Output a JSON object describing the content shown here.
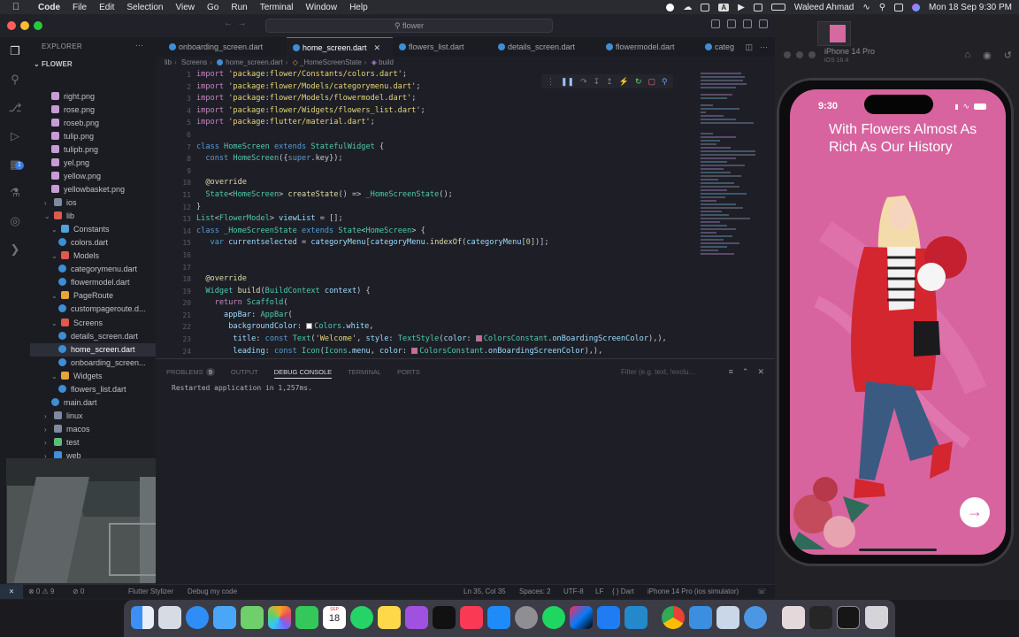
{
  "menubar": {
    "app": "Code",
    "items": [
      "File",
      "Edit",
      "Selection",
      "View",
      "Go",
      "Run",
      "Terminal",
      "Window",
      "Help"
    ],
    "user": "Waleed Ahmad",
    "clock": "Mon 18 Sep  9:30 PM",
    "badge_a": "A"
  },
  "window": {
    "search": "flower"
  },
  "explorer": {
    "header": "EXPLORER",
    "root": "FLOWER",
    "items": [
      {
        "label": "right.png",
        "kind": "image",
        "indent": 2
      },
      {
        "label": "rose.png",
        "kind": "image",
        "indent": 2
      },
      {
        "label": "roseb.png",
        "kind": "image",
        "indent": 2
      },
      {
        "label": "tulip.png",
        "kind": "image",
        "indent": 2
      },
      {
        "label": "tulipb.png",
        "kind": "image",
        "indent": 2
      },
      {
        "label": "yel.png",
        "kind": "image",
        "indent": 2
      },
      {
        "label": "yellow.png",
        "kind": "image",
        "indent": 2
      },
      {
        "label": "yellowbasket.png",
        "kind": "image",
        "indent": 2
      },
      {
        "label": "ios",
        "kind": "folder",
        "indent": 1
      },
      {
        "label": "lib",
        "kind": "folder-open",
        "indent": 1
      },
      {
        "label": "Constants",
        "kind": "folder-open",
        "indent": 2
      },
      {
        "label": "colors.dart",
        "kind": "dart",
        "indent": 3
      },
      {
        "label": "Models",
        "kind": "folder-open",
        "indent": 2
      },
      {
        "label": "categorymenu.dart",
        "kind": "dart",
        "indent": 3
      },
      {
        "label": "flowermodel.dart",
        "kind": "dart",
        "indent": 3
      },
      {
        "label": "PageRoute",
        "kind": "folder-open",
        "indent": 2
      },
      {
        "label": "custompageroute.d...",
        "kind": "dart",
        "indent": 3
      },
      {
        "label": "Screens",
        "kind": "folder-open",
        "indent": 2
      },
      {
        "label": "details_screen.dart",
        "kind": "dart",
        "indent": 3
      },
      {
        "label": "home_screen.dart",
        "kind": "dart",
        "indent": 3,
        "active": true
      },
      {
        "label": "onboarding_screen...",
        "kind": "dart",
        "indent": 3
      },
      {
        "label": "Widgets",
        "kind": "folder-open",
        "indent": 2
      },
      {
        "label": "flowers_list.dart",
        "kind": "dart",
        "indent": 3
      },
      {
        "label": "main.dart",
        "kind": "dart",
        "indent": 2
      },
      {
        "label": "linux",
        "kind": "folder",
        "indent": 1
      },
      {
        "label": "macos",
        "kind": "folder",
        "indent": 1
      },
      {
        "label": "test",
        "kind": "folder",
        "indent": 1
      },
      {
        "label": "web",
        "kind": "folder",
        "indent": 1
      },
      {
        "label": "windows",
        "kind": "folder",
        "indent": 1
      }
    ]
  },
  "tabs": [
    {
      "label": "onboarding_screen.dart"
    },
    {
      "label": "home_screen.dart",
      "active": true
    },
    {
      "label": "flowers_list.dart"
    },
    {
      "label": "details_screen.dart"
    },
    {
      "label": "flowermodel.dart"
    },
    {
      "label": "categ"
    }
  ],
  "breadcrumb": [
    "lib",
    "Screens",
    "home_screen.dart",
    "_HomeScreenState",
    "build"
  ],
  "editor": {
    "line_numbers": [
      "1",
      "2",
      "3",
      "4",
      "5",
      "6",
      "7",
      "8",
      "9",
      "10",
      "11",
      "12",
      "13",
      "14",
      "15",
      "16",
      "17",
      "18",
      "19",
      "20",
      "21",
      "22",
      "23",
      "24"
    ],
    "lines": [
      [
        [
          "k1",
          "import "
        ],
        [
          "s",
          "'package:flower/Constants/colors.dart'"
        ],
        [
          "p",
          ";"
        ]
      ],
      [
        [
          "k1",
          "import "
        ],
        [
          "s",
          "'package:flower/Models/categorymenu.dart'"
        ],
        [
          "p",
          ";"
        ]
      ],
      [
        [
          "k1",
          "import "
        ],
        [
          "s",
          "'package:flower/Models/flowermodel.dart'"
        ],
        [
          "p",
          ";"
        ]
      ],
      [
        [
          "k1",
          "import "
        ],
        [
          "s",
          "'package:flower/Widgets/flowers_list.dart'"
        ],
        [
          "p",
          ";"
        ]
      ],
      [
        [
          "k1",
          "import "
        ],
        [
          "s",
          "'package:flutter/material.dart'"
        ],
        [
          "p",
          ";"
        ]
      ],
      [],
      [
        [
          "k2",
          "class "
        ],
        [
          "t",
          "HomeScreen "
        ],
        [
          "k2",
          "extends "
        ],
        [
          "t",
          "StatefulWidget "
        ],
        [
          "p",
          "{"
        ]
      ],
      [
        [
          "p",
          "  "
        ],
        [
          "k2",
          "const "
        ],
        [
          "t",
          "HomeScreen"
        ],
        [
          "p",
          "({"
        ],
        [
          "k2",
          "super"
        ],
        [
          "p",
          ".key});"
        ]
      ],
      [],
      [
        [
          "p",
          "  "
        ],
        [
          "f",
          "@override"
        ]
      ],
      [
        [
          "p",
          "  "
        ],
        [
          "t",
          "State"
        ],
        [
          "p",
          "<"
        ],
        [
          "t",
          "HomeScreen"
        ],
        [
          "p",
          "> "
        ],
        [
          "f",
          "createState"
        ],
        [
          "p",
          "() => "
        ],
        [
          "t",
          "_HomeScreenState"
        ],
        [
          "p",
          "();"
        ]
      ],
      [
        [
          "p",
          "}"
        ]
      ],
      [
        [
          "t",
          "List"
        ],
        [
          "p",
          "<"
        ],
        [
          "t",
          "FlowerModel"
        ],
        [
          "p",
          "> "
        ],
        [
          "v",
          "viewList"
        ],
        [
          "p",
          " = [];"
        ]
      ],
      [
        [
          "k2",
          "class "
        ],
        [
          "t",
          "_HomeScreenState "
        ],
        [
          "k2",
          "extends "
        ],
        [
          "t",
          "State"
        ],
        [
          "p",
          "<"
        ],
        [
          "t",
          "HomeScreen"
        ],
        [
          "p",
          "> {"
        ]
      ],
      [
        [
          "p",
          "   "
        ],
        [
          "k2",
          "var "
        ],
        [
          "v",
          "currentselected"
        ],
        [
          "p",
          " = "
        ],
        [
          "v",
          "categoryMenu"
        ],
        [
          "p",
          "["
        ],
        [
          "v",
          "categoryMenu"
        ],
        [
          "p",
          "."
        ],
        [
          "f",
          "indexOf"
        ],
        [
          "p",
          "("
        ],
        [
          "v",
          "categoryMenu"
        ],
        [
          "p",
          "["
        ],
        [
          "n",
          "0"
        ],
        [
          "p",
          "])];"
        ]
      ],
      [],
      [],
      [
        [
          "p",
          "  "
        ],
        [
          "f",
          "@override"
        ]
      ],
      [
        [
          "p",
          "  "
        ],
        [
          "t",
          "Widget "
        ],
        [
          "f",
          "build"
        ],
        [
          "p",
          "("
        ],
        [
          "t",
          "BuildContext "
        ],
        [
          "v",
          "context"
        ],
        [
          "p",
          ") {"
        ]
      ],
      [
        [
          "p",
          "    "
        ],
        [
          "k1",
          "return "
        ],
        [
          "t",
          "Scaffold"
        ],
        [
          "p",
          "("
        ]
      ],
      [
        [
          "p",
          "      "
        ],
        [
          "v",
          "appBar"
        ],
        [
          "p",
          ": "
        ],
        [
          "t",
          "AppBar"
        ],
        [
          "p",
          "("
        ]
      ],
      [
        [
          "p",
          "       "
        ],
        [
          "v",
          "backgroundColor"
        ],
        [
          "p",
          ": "
        ],
        [
          "sw",
          "#ffffff"
        ],
        [
          "t",
          "Colors"
        ],
        [
          "p",
          "."
        ],
        [
          "v",
          "white"
        ],
        [
          "p",
          ","
        ]
      ],
      [
        [
          "p",
          "        "
        ],
        [
          "v",
          "title"
        ],
        [
          "p",
          ": "
        ],
        [
          "k2",
          "const "
        ],
        [
          "t",
          "Text"
        ],
        [
          "p",
          "("
        ],
        [
          "s",
          "'Welcome'"
        ],
        [
          "p",
          ", "
        ],
        [
          "v",
          "style"
        ],
        [
          "p",
          ": "
        ],
        [
          "t",
          "TextStyle"
        ],
        [
          "p",
          "("
        ],
        [
          "v",
          "color"
        ],
        [
          "p",
          ": "
        ],
        [
          "sw",
          "#d7649f"
        ],
        [
          "t",
          "ColorsConstant"
        ],
        [
          "p",
          "."
        ],
        [
          "v",
          "onBoardingScreenColor"
        ],
        [
          "p",
          "),),"
        ]
      ],
      [
        [
          "p",
          "        "
        ],
        [
          "v",
          "leading"
        ],
        [
          "p",
          ": "
        ],
        [
          "k2",
          "const "
        ],
        [
          "t",
          "Icon"
        ],
        [
          "p",
          "("
        ],
        [
          "t",
          "Icons"
        ],
        [
          "p",
          "."
        ],
        [
          "v",
          "menu"
        ],
        [
          "p",
          ", "
        ],
        [
          "v",
          "color"
        ],
        [
          "p",
          ": "
        ],
        [
          "sw",
          "#d7649f"
        ],
        [
          "t",
          "ColorsConstant"
        ],
        [
          "p",
          "."
        ],
        [
          "v",
          "onBoardingScreenColor"
        ],
        [
          "p",
          "),),"
        ]
      ]
    ]
  },
  "panel": {
    "tabs": [
      {
        "label": "PROBLEMS",
        "badge": "9"
      },
      {
        "label": "OUTPUT"
      },
      {
        "label": "DEBUG CONSOLE",
        "active": true
      },
      {
        "label": "TERMINAL"
      },
      {
        "label": "PORTS"
      }
    ],
    "filter_placeholder": "Filter (e.g. text, !exclu...",
    "output": "Restarted application in 1,257ms."
  },
  "statusbar": {
    "left": "⨯",
    "problems": "⊗ 0  ⚠ 9",
    "info": "⊘ 0",
    "flutter": "Flutter Stylizer",
    "debug": "Debug my code",
    "position": "Ln 35, Col 35",
    "spaces": "Spaces: 2",
    "encoding": "UTF-8",
    "eol": "LF",
    "language": "{ } Dart",
    "device": "iPhone 14 Pro (ios simulator)"
  },
  "simulator": {
    "device_name": "iPhone 14 Pro",
    "os": "iOS 16.4",
    "time": "9:30",
    "headline": "With Flowers Almost As Rich As Our History",
    "next_symbol": "→"
  },
  "dock": {
    "calendar_month": "SEP",
    "calendar_day": "18"
  },
  "colors": {
    "accent": "#3a7be0",
    "pink": "#d7649f",
    "editor_bg": "#1e1f26"
  }
}
